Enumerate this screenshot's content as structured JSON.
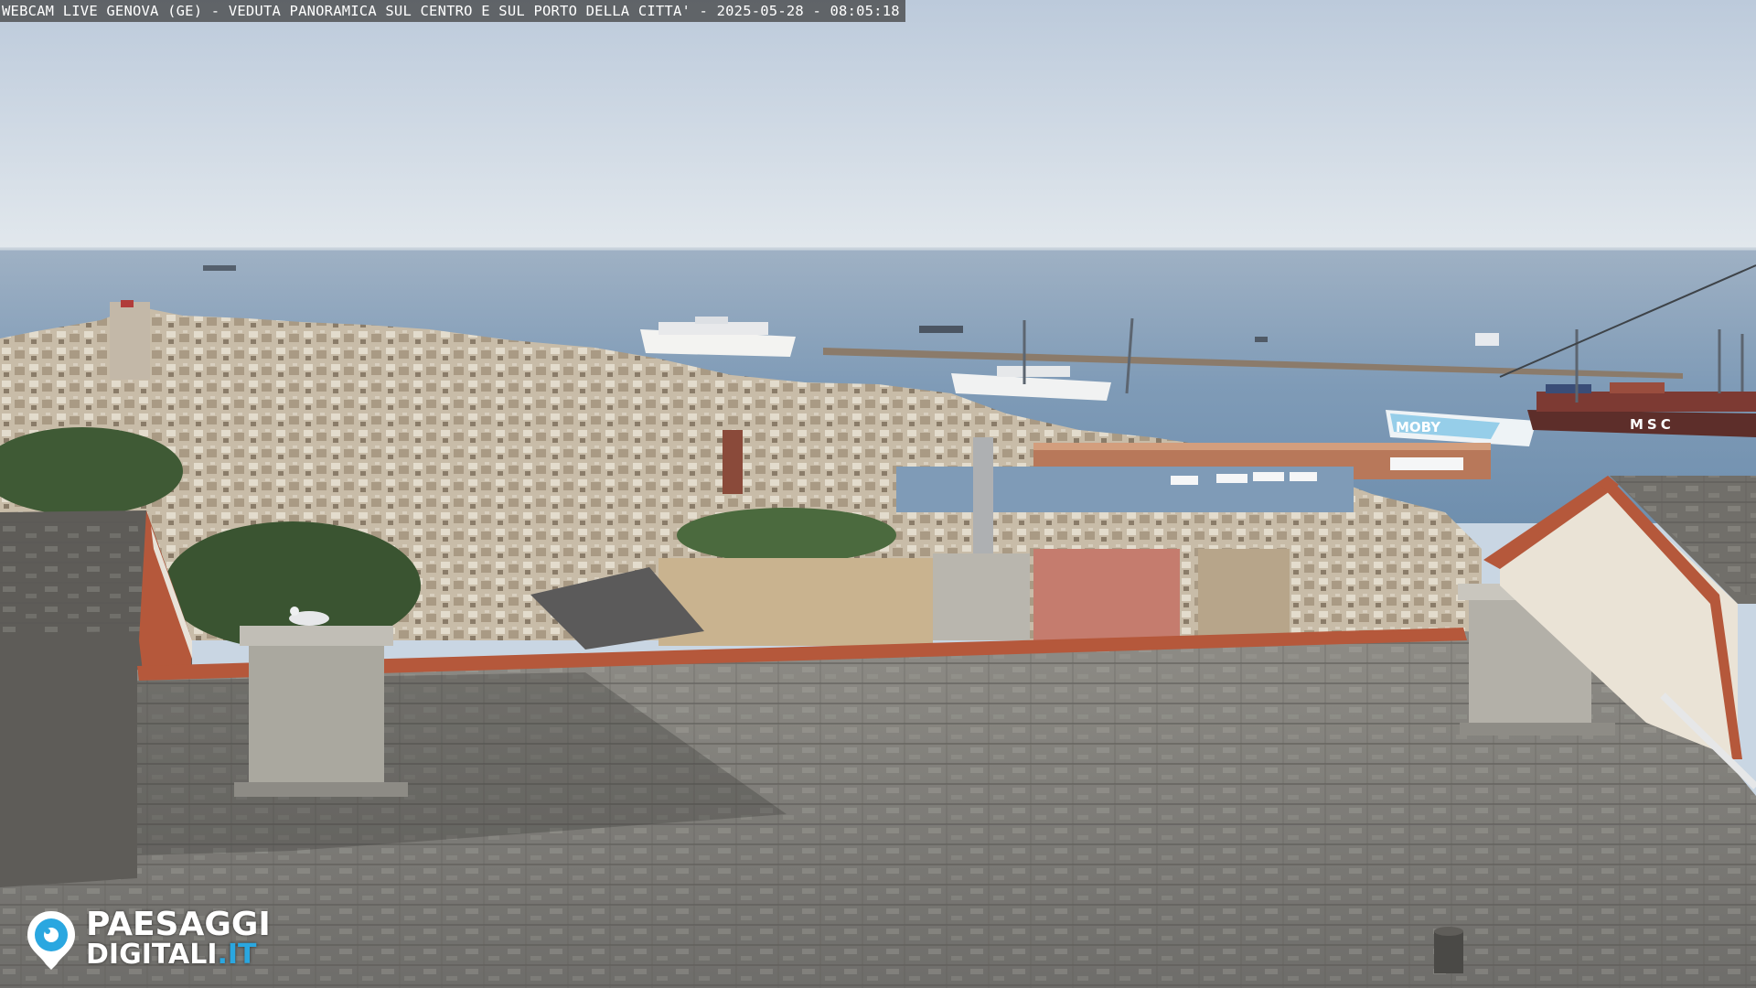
{
  "overlay": {
    "title": "WEBCAM LIVE GENOVA (GE) - VEDUTA PANORAMICA SUL CENTRO E SUL PORTO DELLA CITTA' - 2025-05-28 - 08:05:18"
  },
  "logo": {
    "line1": "PAESAGGI",
    "line2_main": "DIGITALI",
    "line2_accent": ".IT",
    "icon": "camera-eye-icon",
    "accent_color": "#2aa7e0"
  },
  "ship_labels": {
    "container_ship": "MSC",
    "ferry": "MOBY"
  },
  "colors": {
    "sky_top": "#bccadb",
    "sky_horizon": "#dfe6ec",
    "sea": "#7f9bb7",
    "roof": "#7d7b76",
    "tile_trim": "#b5583b"
  }
}
